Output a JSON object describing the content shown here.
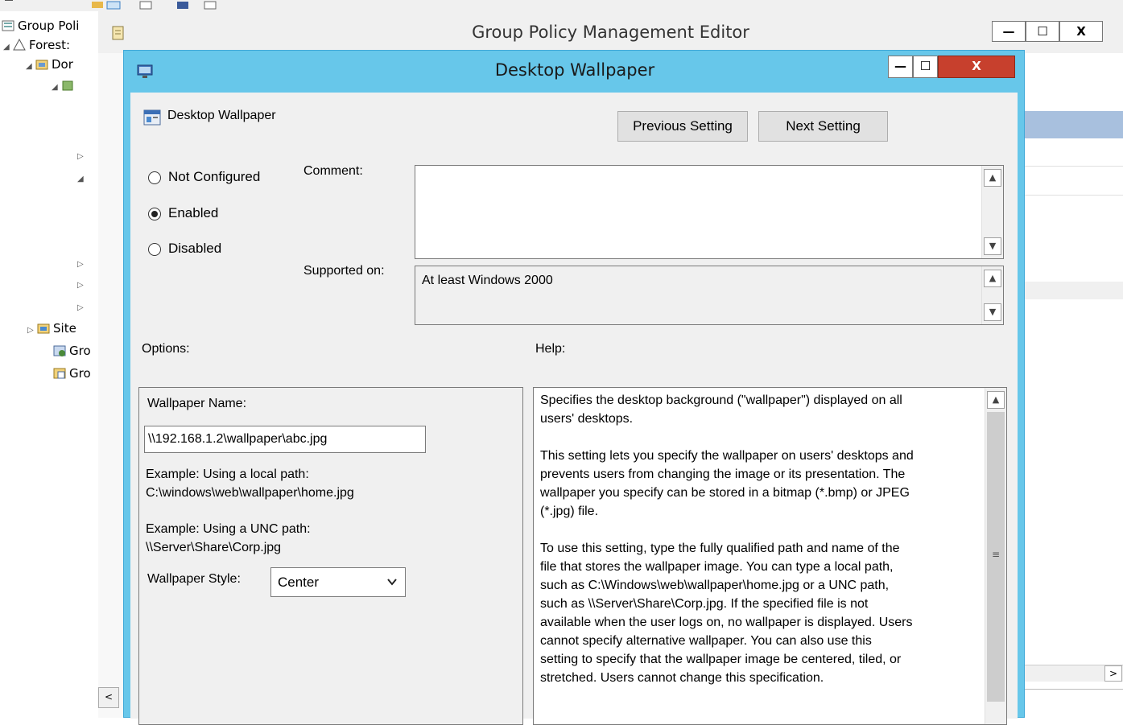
{
  "tree": {
    "items": [
      {
        "label": "Group Poli",
        "icon": "gpmc-icon"
      },
      {
        "label": "Forest:",
        "icon": "forest-icon"
      },
      {
        "label": "Dor",
        "icon": "domains-icon"
      },
      {
        "label": "",
        "icon": "domain-icon"
      },
      {
        "label": "Site",
        "icon": "sites-icon"
      },
      {
        "label": "Gro",
        "icon": "modeling-icon"
      },
      {
        "label": "Gro",
        "icon": "results-icon"
      }
    ]
  },
  "gpme": {
    "title": "Group Policy Management Editor",
    "minimize": "—",
    "maximize": "☐",
    "close": "X"
  },
  "dialog": {
    "title": "Desktop Wallpaper",
    "setting_name": "Desktop Wallpaper",
    "previous_button": "Previous Setting",
    "next_button": "Next Setting",
    "radio": {
      "not_configured": "Not Configured",
      "enabled": "Enabled",
      "disabled": "Disabled",
      "selected": "enabled"
    },
    "comment_label": "Comment:",
    "comment_value": "",
    "supported_label": "Supported on:",
    "supported_value": "At least Windows 2000",
    "options_label": "Options:",
    "help_label": "Help:",
    "options": {
      "wallpaper_name_label": "Wallpaper Name:",
      "wallpaper_name_value": "\\\\192.168.1.2\\wallpaper\\abc.jpg",
      "example_local": "Example: Using a local path:\nC:\\windows\\web\\wallpaper\\home.jpg",
      "example_unc": "Example: Using a UNC path:\n\\\\Server\\Share\\Corp.jpg",
      "style_label": "Wallpaper Style:",
      "style_value": "Center"
    },
    "help_text": "Specifies the desktop background (\"wallpaper\") displayed on all\nusers' desktops.\n\nThis setting lets you specify the wallpaper on users' desktops and\nprevents users from changing the image or its presentation. The\nwallpaper you specify can be stored in a bitmap (*.bmp) or JPEG\n(*.jpg) file.\n\nTo use this setting, type the fully qualified path and name of the\nfile that stores the wallpaper image. You can type a local path,\nsuch as C:\\Windows\\web\\wallpaper\\home.jpg or a UNC path,\nsuch as \\\\Server\\Share\\Corp.jpg. If the specified file is not\navailable when the user logs on, no wallpaper is displayed. Users\ncannot specify alternative wallpaper. You can also use this\nsetting to specify that the wallpaper image be centered, tiled, or\nstretched. Users cannot change this specification."
  },
  "colors": {
    "dialog_title_bg": "#67c7ea",
    "close_button": "#c7402d"
  }
}
